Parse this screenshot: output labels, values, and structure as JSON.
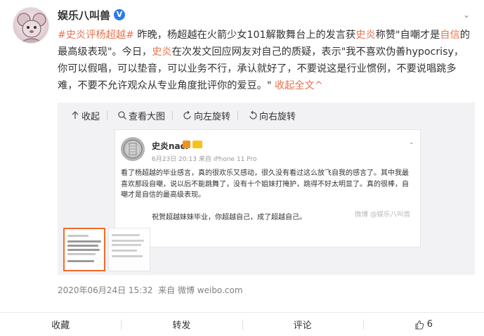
{
  "post": {
    "username": "娱乐八叫兽",
    "verified_badge": "V",
    "more_glyph": "⌄",
    "text": {
      "tag": "#史炎评杨超越#",
      "p1": " 昨晚，杨超越在火箭少女101解散舞台上的发言获",
      "link1": "史炎",
      "p2": "称赞\"自嘲才是",
      "link2": "自信",
      "p3": "的最高级表现\"。今日，",
      "link3": "史炎",
      "p4": "在次发文回应网友对自己的质疑，表示\"我不喜欢伪善hypocrisy，你可以假唱，可以垫音，可以业务不行，承认就好了，不要说这是行业惯例，不要说唱跳多难，不要不允许观众从专业角度批评你的爱豆。\" ",
      "collapse": "收起全文^"
    },
    "timestamp": "2020年06月24日 15:32",
    "source_prefix": "来自",
    "source": "微博 weibo.com"
  },
  "image_toolbar": {
    "collapse": "收起",
    "view_large": "查看大图",
    "rotate_left": "向左旋转",
    "rotate_right": "向右旋转"
  },
  "screenshot": {
    "name": "史炎nacl",
    "meta": "6月23日 20:13 来自 iPhone 11 Pro",
    "chevron": "⌄",
    "body": "看了杨超越的毕业感言，真的很欢乐又感动，很久没有看过这么放飞自我的感言了。其中我最喜欢那段自嘲，说以后不能跳舞了，没有十个姐妹打掩护，跳得不好太明显了。真的很棒，自嘲才是自信的最高级表现。",
    "closing": "祝贺超越妹妹毕业，你超越自己，成了超越自己。",
    "watermark": "微博 @娱乐八叫兽"
  },
  "actions": {
    "favorite": "收藏",
    "repost": "转发",
    "comment": "评论",
    "like_count": "6"
  },
  "colors": {
    "link": "#eb7350",
    "verified": "#2a7ce8",
    "thumb_selected": "#f26b2a",
    "panel_bg": "#f2f2f5"
  }
}
